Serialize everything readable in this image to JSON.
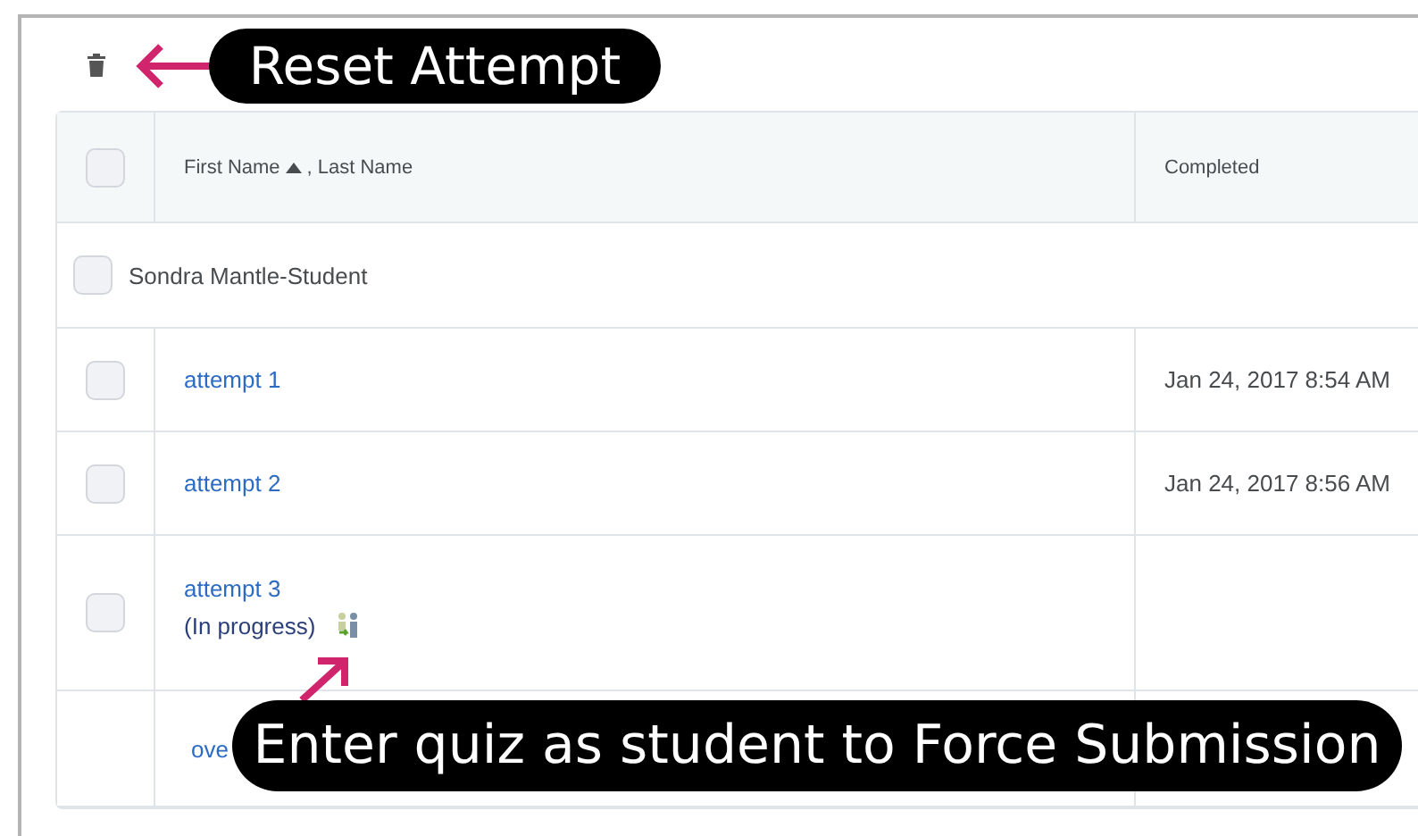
{
  "callouts": [
    {
      "text": "Reset Attempt",
      "kind": "left"
    },
    {
      "text": "Enter quiz as student to Force Submission",
      "kind": "up"
    }
  ],
  "table": {
    "header": {
      "first": "First Name",
      "second": ", Last Name",
      "sorted": true,
      "completed": "Completed",
      "checked": false
    },
    "rows": [
      {
        "kind": "group",
        "name": "Sondra Mantle-Student",
        "checked": false
      },
      {
        "kind": "attempt",
        "label": "attempt 1",
        "completed": "Jan 24, 2017 8:54 AM",
        "checked": false
      },
      {
        "kind": "attempt",
        "label": "attempt 2",
        "completed": "Jan 24, 2017 8:56 AM",
        "checked": false
      },
      {
        "kind": "attempt",
        "label": "attempt 3",
        "status": "(In progress)",
        "checked": false
      },
      {
        "kind": "overall",
        "label": "ove"
      }
    ]
  }
}
